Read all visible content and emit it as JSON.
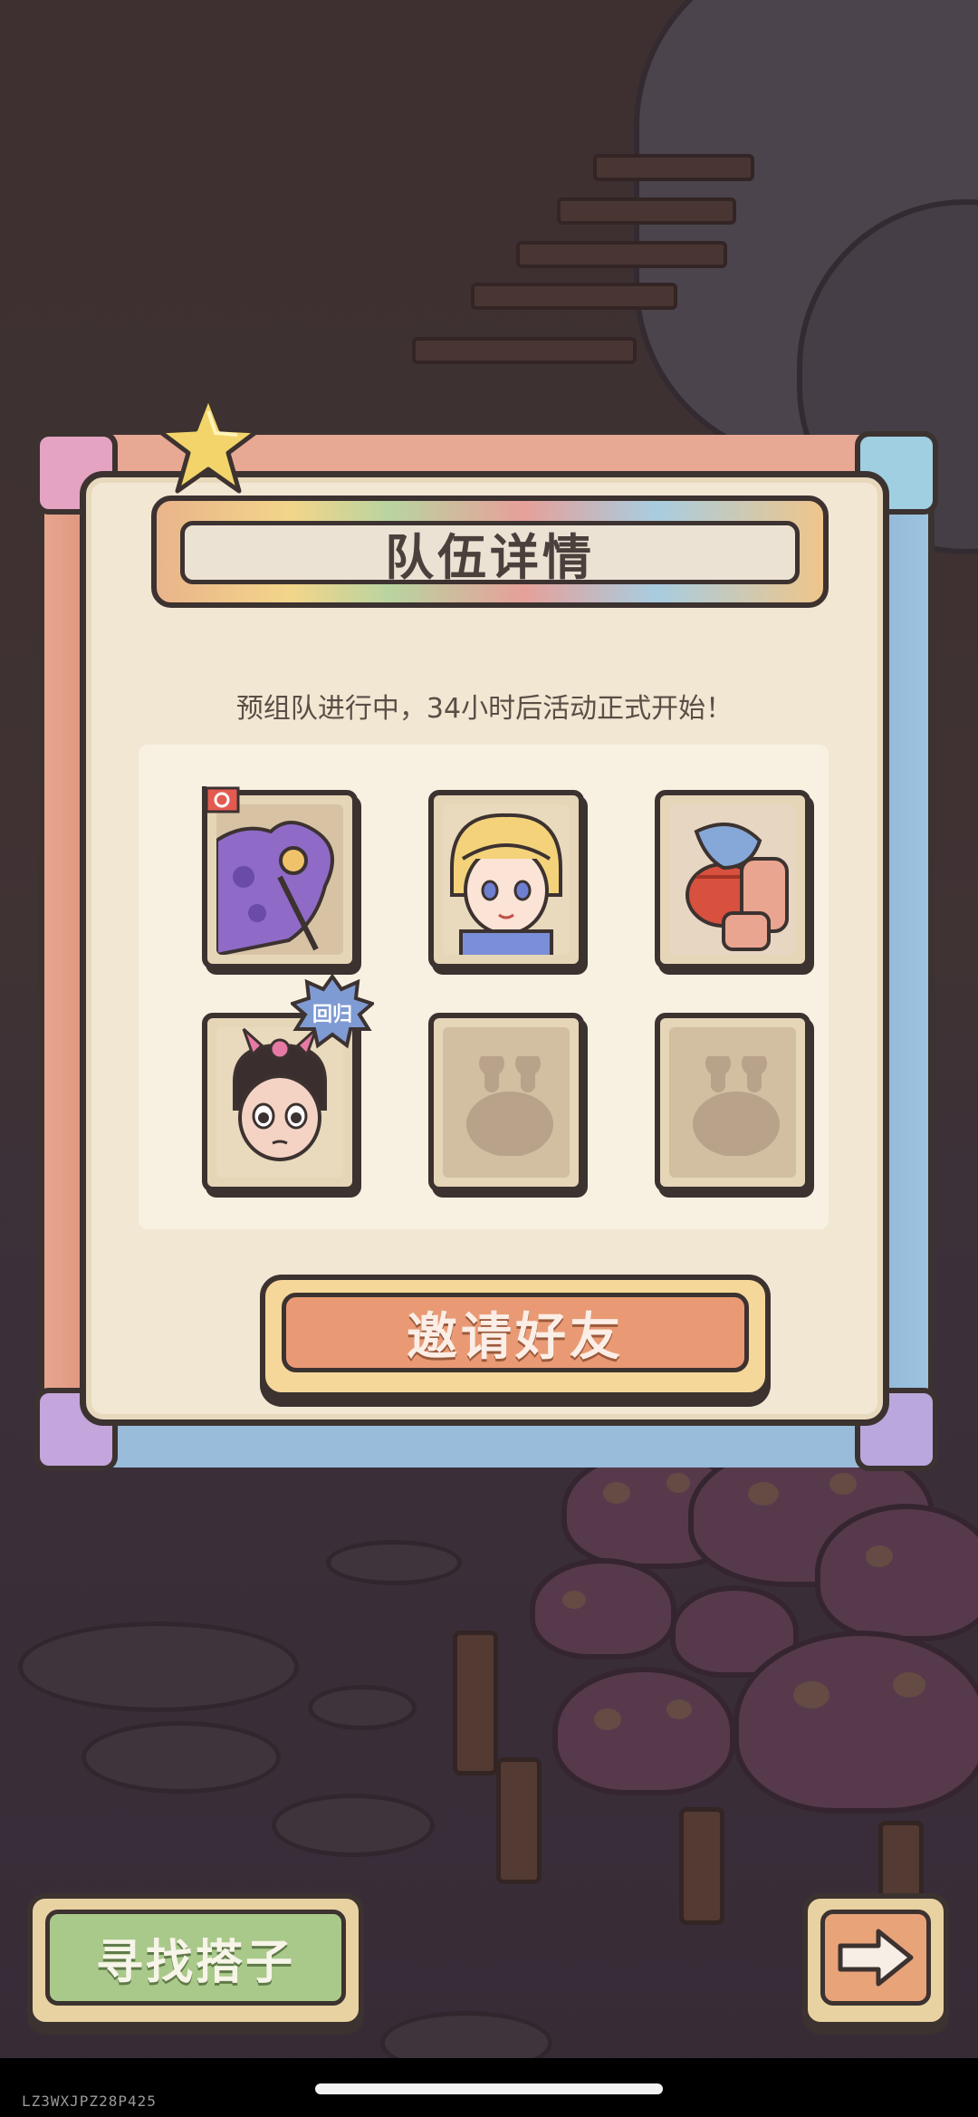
{
  "dialog": {
    "title": "队伍详情",
    "subtitle": "预组队进行中，34小时后活动正式开始！",
    "invite_label": "邀请好友"
  },
  "team_slots": [
    {
      "state": "leader",
      "avatar": "purple-creature"
    },
    {
      "state": "filled",
      "avatar": "blonde-girl"
    },
    {
      "state": "filled",
      "avatar": "red-helmet-creature"
    },
    {
      "state": "filled",
      "avatar": "pink-bow-girl",
      "badge": "回归"
    },
    {
      "state": "empty"
    },
    {
      "state": "empty"
    }
  ],
  "bottom": {
    "find_partner_label": "寻找搭子",
    "next_icon": "arrow-right-icon"
  },
  "build_tag": "LZ3WXJPZ28P425",
  "colors": {
    "panel": "#f2e7d3",
    "invite_button": "#e99a74",
    "find_button": "#a9c98a",
    "outline": "#3c3230"
  }
}
